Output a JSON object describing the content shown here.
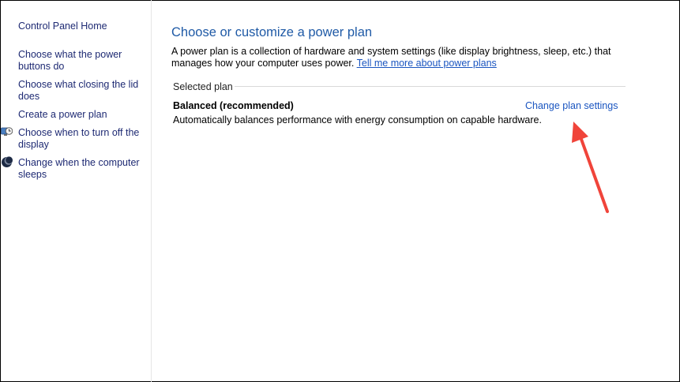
{
  "sidebar": {
    "home_label": "Control Panel Home",
    "links": [
      "Choose what the power buttons do",
      "Choose what closing the lid does",
      "Create a power plan",
      "Choose when to turn off the display",
      "Change when the computer sleeps"
    ],
    "icons": [
      "display-timer-icon",
      "sleep-moon-icon"
    ]
  },
  "main": {
    "title": "Choose or customize a power plan",
    "intro_text": "A power plan is a collection of hardware and system settings (like display brightness, sleep, etc.) that manages how your computer uses power.",
    "intro_link": "Tell me more about power plans",
    "section_label": "Selected plan",
    "plan": {
      "name": "Balanced (recommended)",
      "description": "Automatically balances performance with energy consumption on capable hardware.",
      "settings_link": "Change plan settings"
    }
  },
  "annotation": {
    "arrow_color": "#f0443a"
  },
  "colors": {
    "nav_link": "#1e2a73",
    "title": "#1f5aa6",
    "link": "#1a55c0"
  }
}
